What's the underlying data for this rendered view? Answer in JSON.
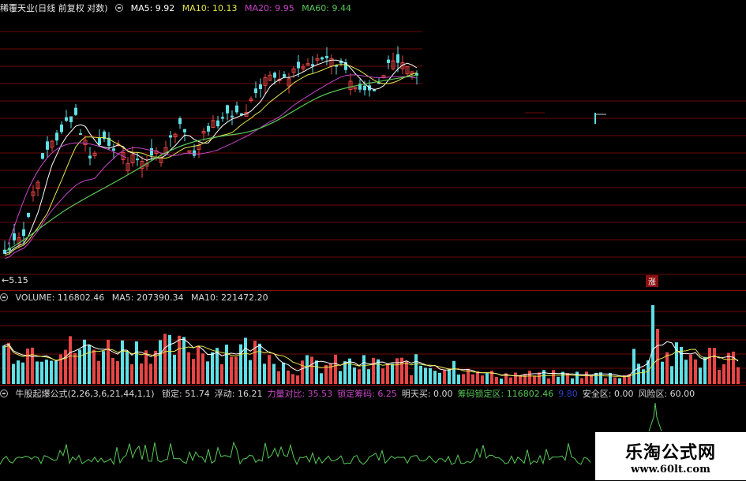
{
  "main": {
    "stock_name": "稀覆天业(日线 前复权 对数)",
    "ma5_label": "MA5: 9.92",
    "ma10_label": "MA10: 10.13",
    "ma20_label": "MA20: 9.95",
    "ma60_label": "MA60: 9.44",
    "low_label": "←5.15",
    "flag_label": "涨"
  },
  "volume": {
    "title": "VOLUME: 116802.46",
    "ma5_label": "MA5: 207390.34",
    "ma10_label": "MA10: 221472.20"
  },
  "indicator": {
    "formula": "牛股起爆公式(2,26,3,6,21,44,1,1)",
    "items": [
      {
        "label": "锁定: 51.74",
        "color": "#d8d8d8"
      },
      {
        "label": "浮动: 16.21",
        "color": "#d8d8d8"
      },
      {
        "label": "力量对比: 35.53",
        "color": "#c846c8"
      },
      {
        "label": "锁定筹码: 6.25",
        "color": "#c846c8"
      },
      {
        "label": "明天买: 0.00",
        "color": "#d8d8d8"
      },
      {
        "label": "筹码锁定区: 116802.46",
        "color": "#58c858"
      },
      {
        "label": "9.80",
        "color": "#2e3fc8"
      },
      {
        "label": "安全区: 0.00",
        "color": "#d8d8d8"
      },
      {
        "label": "风险区: 60.00",
        "color": "#d8d8d8"
      }
    ]
  },
  "watermark": {
    "title": "乐淘公式网",
    "url": "www.60lt.com"
  },
  "colors": {
    "up": "#e84545",
    "down": "#5ee0e6",
    "ma5": "#ffffff",
    "ma10": "#e6e64a",
    "ma20": "#c846c8",
    "ma60": "#58c858",
    "grid": "#6e0a0a"
  }
}
